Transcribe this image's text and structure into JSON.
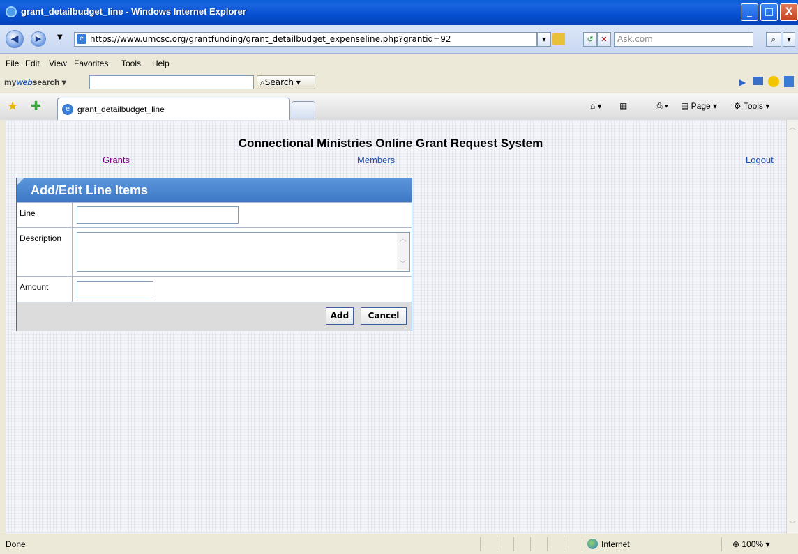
{
  "window": {
    "title": "grant_detailbudget_line - Windows Internet Explorer",
    "min_glyph": "_",
    "max_glyph": "□",
    "close_glyph": "X"
  },
  "address": {
    "url": "https://www.umcsc.org/grantfunding/grant_detailbudget_expenseline.php?grantid=92",
    "search_placeholder": "Ask.com"
  },
  "menu": [
    "File",
    "Edit",
    "View",
    "Favorites",
    "Tools",
    "Help"
  ],
  "toolbar": {
    "brand_prefix": "my",
    "brand_mid": "web",
    "brand_suffix": "search",
    "search_button": "Search"
  },
  "tabs": {
    "active_label": "grant_detailbudget_line",
    "page_label": "Page",
    "tools_label": "Tools"
  },
  "page": {
    "system_title": "Connectional Ministries Online Grant Request System",
    "nav_grants": "Grants",
    "nav_members": "Members",
    "nav_logout": "Logout",
    "panel_title": "Add/Edit Line Items",
    "field_line": "Line",
    "field_description": "Description",
    "field_amount": "Amount",
    "add_button": "Add",
    "cancel_button": "Cancel",
    "line_value": "",
    "description_value": "",
    "amount_value": ""
  },
  "status": {
    "text": "Done",
    "zone": "Internet",
    "zoom": "100%"
  },
  "colors": {
    "panel_header": "#4A86D0",
    "visited_link": "#800080",
    "link": "#1F4FB0"
  }
}
